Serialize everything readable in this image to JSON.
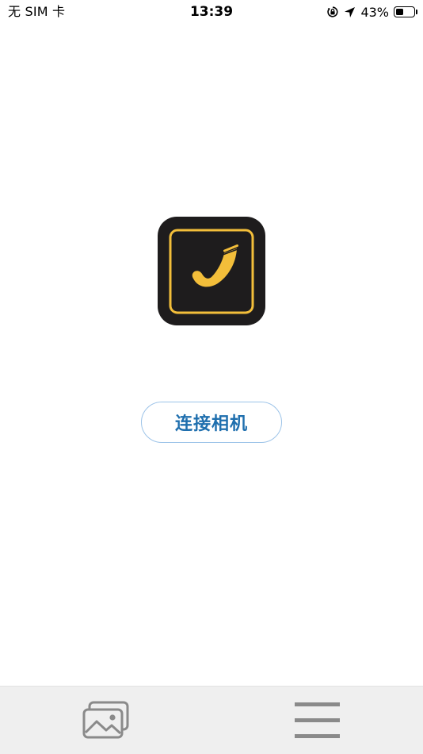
{
  "status_bar": {
    "carrier": "无 SIM 卡",
    "time": "13:39",
    "battery_percent": "43%",
    "battery_level": 0.43,
    "icons": [
      "orientation-lock-icon",
      "location-arrow-icon",
      "battery-icon"
    ]
  },
  "main": {
    "logo_icon": "checkmark-app-logo",
    "connect_button_label": "连接相机"
  },
  "tab_bar": {
    "left_icon": "gallery-icon",
    "right_icon": "menu-icon"
  },
  "colors": {
    "logo_background": "#1e1c1d",
    "logo_accent": "#f3be3a",
    "button_text": "#1f6fae",
    "button_border": "#9cc3e8",
    "tab_bar_background": "#efefef",
    "tab_icon": "#8a8a8a"
  }
}
